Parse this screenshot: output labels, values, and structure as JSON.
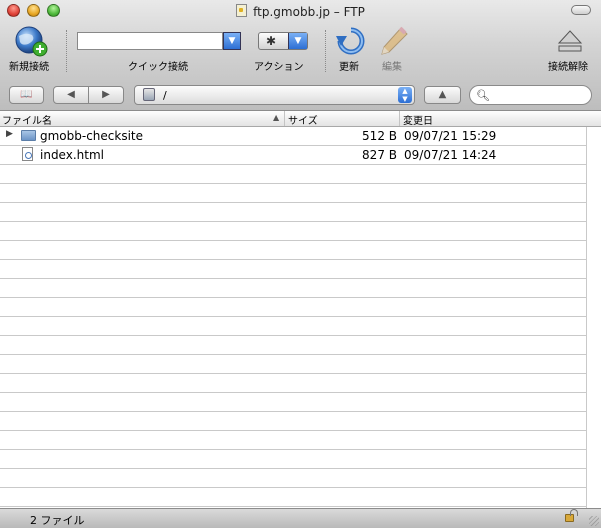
{
  "window": {
    "title": "ftp.gmobb.jp – FTP"
  },
  "toolbar": {
    "new_connection_label": "新規接続",
    "quick_connect_label": "クイック接続",
    "quick_connect_value": "",
    "action_label": "アクション",
    "refresh_label": "更新",
    "edit_label": "編集",
    "disconnect_label": "接続解除"
  },
  "nav": {
    "path": "/",
    "search_placeholder": ""
  },
  "columns": {
    "filename": "ファイル名",
    "size": "サイズ",
    "modified": "変更日"
  },
  "files": [
    {
      "name": "gmobb-checksite",
      "size": "512 B",
      "modified": "09/07/21 15:29",
      "kind": "folder"
    },
    {
      "name": "index.html",
      "size": "827 B",
      "modified": "09/07/21 14:24",
      "kind": "file"
    }
  ],
  "status": {
    "count": "2 ファイル"
  },
  "colors": {
    "accent_blue": "#2d6fd4",
    "row_divider": "#c9c9c9"
  }
}
